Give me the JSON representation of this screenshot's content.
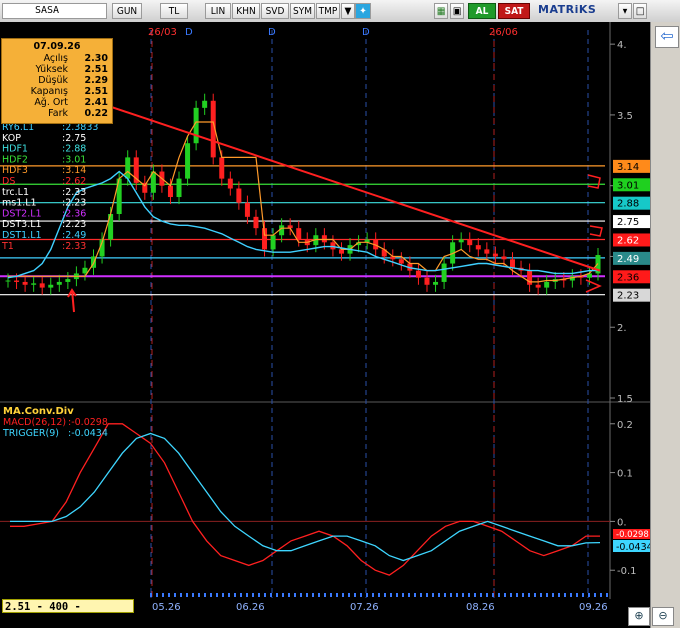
{
  "toolbar": {
    "symbol": "SASA",
    "buttons": [
      "GUN",
      "TL",
      "LIN",
      "KHN",
      "SVD",
      "SYM",
      "TMP"
    ],
    "al_label": "AL",
    "sat_label": "SAT",
    "brand": "MATRiKS"
  },
  "price_box": {
    "date": "07.09.26",
    "rows": [
      {
        "label": "Açılış",
        "value": "2.30"
      },
      {
        "label": "Yüksek",
        "value": "2.51"
      },
      {
        "label": "Düşük",
        "value": "2.29"
      },
      {
        "label": "Kapanış",
        "value": "2.51"
      },
      {
        "label": "Ağ. Ort",
        "value": "2.41"
      },
      {
        "label": "Fark",
        "value": "0.22"
      }
    ]
  },
  "indicators": [
    {
      "label": "RY6.L1",
      "value": ":2.3833",
      "color": "#3fd0ff"
    },
    {
      "label": "KOP",
      "value": ":2.75",
      "color": "#ffffff"
    },
    {
      "label": "HDF1",
      "value": ":2.88",
      "color": "#3ee0e0"
    },
    {
      "label": "HDF2",
      "value": ":3.01",
      "color": "#38e038"
    },
    {
      "label": "HDF3",
      "value": ":3.14",
      "color": "#ff9a2a"
    },
    {
      "label": "DS",
      "value": ":2.62",
      "color": "#ff2a2a"
    },
    {
      "label": "trc.L1",
      "value": ":2.33",
      "color": "#ffffff"
    },
    {
      "label": "ms1.L1",
      "value": ":2.23",
      "color": "#ffffff"
    },
    {
      "label": "DST2.L1",
      "value": ":2.36",
      "color": "#d030ff"
    },
    {
      "label": "DST3.L1",
      "value": ":2.23",
      "color": "#ffffff"
    },
    {
      "label": "DST1.L1",
      "value": ":2.49",
      "color": "#3fd0ff"
    },
    {
      "label": "T1",
      "value": ":2.33",
      "color": "#ff3030"
    }
  ],
  "top_markers": [
    {
      "text": "26/03",
      "color": "#ff3030"
    },
    {
      "text": "D",
      "color": "#3a7aff"
    },
    {
      "text": "D",
      "color": "#3a7aff"
    },
    {
      "text": "D",
      "color": "#3a7aff"
    },
    {
      "text": "26/06",
      "color": "#ff3030"
    }
  ],
  "right_labels": [
    {
      "text": "3.14",
      "bg": "#ff8a1a",
      "fg": "#000000"
    },
    {
      "text": "3.01",
      "bg": "#1fd01f",
      "fg": "#000000"
    },
    {
      "text": "2.88",
      "bg": "#16c8c8",
      "fg": "#000000"
    },
    {
      "text": "2.75",
      "bg": "#ffffff",
      "fg": "#000000"
    },
    {
      "text": "2.62",
      "bg": "#ff1a1a",
      "fg": "#ffffff"
    },
    {
      "text": "2.49",
      "bg": "#2a8a8a",
      "fg": "#ffffff"
    },
    {
      "text": "2.36",
      "bg": "#ff1a1a",
      "fg": "#000000"
    },
    {
      "text": "2.23",
      "bg": "#d8d8d8",
      "fg": "#000000"
    }
  ],
  "macd_panel": {
    "title": "MA.Conv.Div",
    "macd_label": "MACD(26,12)",
    "macd_value": ":-0.0298",
    "trigger_label": "TRIGGER(9)",
    "trigger_value": ":-0.0434",
    "macd_last": "-0.0298",
    "trigger_last": "-0.0434",
    "macd_color": "#ff2020",
    "trigger_color": "#3ed6ff"
  },
  "status": "2.51 - 400 - 15:27:23",
  "date_labels": [
    "05.26",
    "06.26",
    "07.26",
    "08.26",
    "09.26"
  ],
  "annotations": {
    "arrow_label": "1",
    "mark_label": "5"
  },
  "chart_data": [
    {
      "type": "candlestick",
      "title": "",
      "xlabel": "",
      "ylabel": "",
      "ylim": [
        1.5,
        4.1
      ],
      "yticks": [
        "4.",
        "3.5",
        "3.",
        "2.5",
        "2.",
        "1.5"
      ],
      "x_ticks": [
        "05.26",
        "06.26",
        "07.26",
        "08.26",
        "09.26"
      ],
      "last_close": 2.51,
      "horizontal_levels": [
        {
          "name": "HDF3",
          "value": 3.14,
          "color": "#ff9a2a"
        },
        {
          "name": "HDF2",
          "value": 3.01,
          "color": "#38e038"
        },
        {
          "name": "HDF1",
          "value": 2.88,
          "color": "#3ee0e0"
        },
        {
          "name": "KOP",
          "value": 2.75,
          "color": "#ffffff"
        },
        {
          "name": "DS",
          "value": 2.62,
          "color": "#ff2a2a"
        },
        {
          "name": "DST1",
          "value": 2.49,
          "color": "#3fd0ff"
        },
        {
          "name": "DST2",
          "value": 2.36,
          "color": "#d030ff"
        },
        {
          "name": "DST3",
          "value": 2.23,
          "color": "#ffffff"
        }
      ],
      "trendline": {
        "from": [
          7,
          3.7
        ],
        "to": [
          99,
          2.4
        ],
        "color": "#ff2020"
      },
      "series": [
        {
          "name": "RY6.L1",
          "values": [
            2.35,
            2.36,
            2.38,
            2.4,
            2.45,
            2.55,
            2.7,
            2.85,
            2.95,
            2.98,
            3.0,
            3.02,
            3.05,
            3.1,
            3.05,
            2.95,
            2.85,
            2.78,
            2.75,
            2.73,
            2.72,
            2.72,
            2.71,
            2.7,
            2.68,
            2.66,
            2.63,
            2.6,
            2.57,
            2.55,
            2.54,
            2.53,
            2.53,
            2.53,
            2.54,
            2.55,
            2.56,
            2.57,
            2.57,
            2.56,
            2.55,
            2.54,
            2.53,
            2.5,
            2.48,
            2.46,
            2.44,
            2.42,
            2.41,
            2.4,
            2.4,
            2.41,
            2.42,
            2.43,
            2.44,
            2.45,
            2.45,
            2.44,
            2.43,
            2.42,
            2.41,
            2.4,
            2.4,
            2.39,
            2.38,
            2.38,
            2.38,
            2.39,
            2.4,
            2.4
          ],
          "color": "#3fd0ff"
        }
      ]
    },
    {
      "type": "line",
      "title": "MA.Conv.Div",
      "xlabel": "",
      "ylabel": "",
      "ylim": [
        -0.12,
        0.22
      ],
      "yticks": [
        "0.2",
        "0.1",
        "0.",
        "-0.1"
      ],
      "series": [
        {
          "name": "MACD(26,12)",
          "values": [
            -0.01,
            -0.01,
            -0.005,
            0.0,
            0.04,
            0.1,
            0.15,
            0.2,
            0.2,
            0.18,
            0.16,
            0.12,
            0.06,
            0.0,
            -0.04,
            -0.07,
            -0.08,
            -0.09,
            -0.08,
            -0.06,
            -0.04,
            -0.03,
            -0.02,
            -0.03,
            -0.05,
            -0.08,
            -0.1,
            -0.11,
            -0.09,
            -0.06,
            -0.03,
            -0.01,
            0.0,
            0.0,
            -0.01,
            -0.02,
            -0.04,
            -0.06,
            -0.07,
            -0.06,
            -0.05,
            -0.03,
            -0.03
          ],
          "color": "#ff2020"
        },
        {
          "name": "TRIGGER(9)",
          "values": [
            0.0,
            0.0,
            0.0,
            0.0,
            0.01,
            0.03,
            0.06,
            0.1,
            0.14,
            0.17,
            0.18,
            0.17,
            0.14,
            0.1,
            0.06,
            0.02,
            -0.01,
            -0.03,
            -0.05,
            -0.06,
            -0.06,
            -0.05,
            -0.04,
            -0.03,
            -0.03,
            -0.04,
            -0.05,
            -0.07,
            -0.08,
            -0.07,
            -0.06,
            -0.04,
            -0.02,
            -0.01,
            0.0,
            -0.01,
            -0.02,
            -0.03,
            -0.04,
            -0.05,
            -0.05,
            -0.044,
            -0.0434
          ],
          "color": "#3ed6ff"
        }
      ]
    }
  ]
}
